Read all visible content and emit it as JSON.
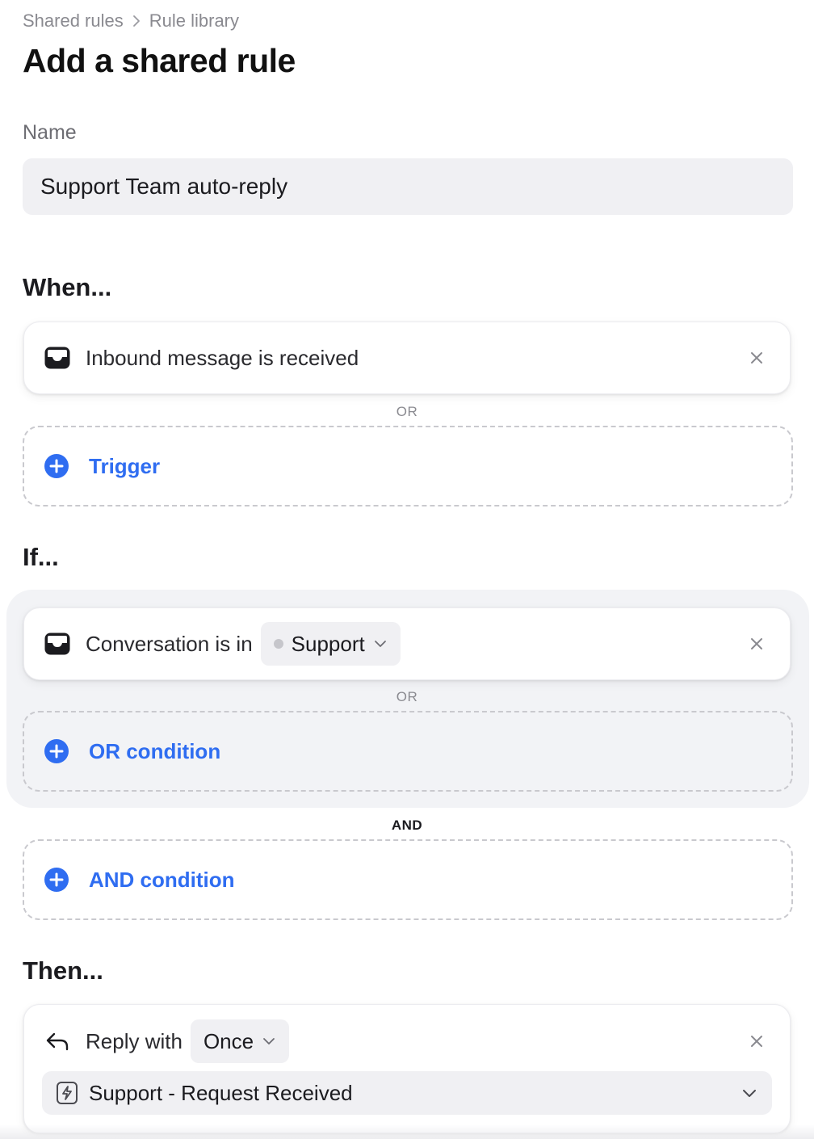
{
  "breadcrumb": {
    "parent": "Shared rules",
    "current": "Rule library"
  },
  "page_title": "Add a shared rule",
  "name_field": {
    "label": "Name",
    "value": "Support Team auto-reply"
  },
  "when": {
    "title": "When...",
    "trigger_label": "Inbound message is received",
    "separator": "OR",
    "add_label": "Trigger"
  },
  "if": {
    "title": "If...",
    "condition_prefix": "Conversation is in",
    "condition_value": "Support",
    "or_separator": "OR",
    "add_or_label": "OR condition",
    "and_separator": "AND",
    "add_and_label": "AND condition"
  },
  "then": {
    "title": "Then...",
    "action_prefix": "Reply with",
    "frequency": "Once",
    "template": "Support - Request Received"
  },
  "colors": {
    "accent": "#2f6df1",
    "muted_text": "#8a8a90"
  }
}
